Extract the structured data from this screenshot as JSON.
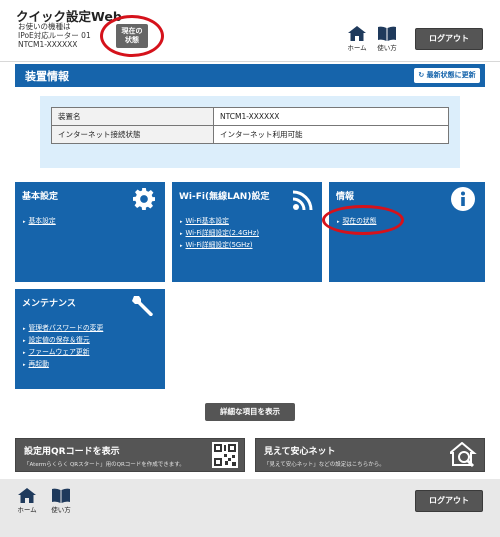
{
  "header": {
    "app_title": "クイック設定Web",
    "device_label": "お使いの機種は",
    "device_model": "IPoE対応ルーター 01",
    "device_id": "NTCM1-XXXXXX",
    "status_button_line1": "現在の",
    "status_button_line2": "状態",
    "home_label": "ホーム",
    "manual_label": "使い方",
    "logout_label": "ログアウト"
  },
  "section": {
    "title": "装置情報",
    "refresh_label": "最新状態に更新"
  },
  "info_table": [
    {
      "key": "装置名",
      "value": "NTCM1-XXXXXX"
    },
    {
      "key": "インターネット接続状態",
      "value": "インターネット利用可能"
    }
  ],
  "tiles": {
    "basic": {
      "title": "基本設定",
      "links": [
        "基本設定"
      ],
      "icon": "gear-icon"
    },
    "wifi": {
      "title": "Wi-Fi(無線LAN)設定",
      "links": [
        "Wi-Fi基本設定",
        "Wi-Fi詳細設定(2.4GHz)",
        "Wi-Fi詳細設定(5GHz)"
      ],
      "icon": "wifi-icon"
    },
    "info": {
      "title": "情報",
      "links": [
        "現在の状態"
      ],
      "icon": "info-icon"
    },
    "maintenance": {
      "title": "メンテナンス",
      "links": [
        "管理者パスワードの変更",
        "設定値の保存＆復元",
        "ファームウェア更新",
        "再起動"
      ],
      "icon": "wrench-icon"
    }
  },
  "advanced_button": "詳細な項目を表示",
  "banners": {
    "qr": {
      "title": "設定用QRコードを表示",
      "subtitle": "「Atermらくらく QRスタート」用のQRコードを作成できます。",
      "icon": "qr-code-icon"
    },
    "safety": {
      "title": "見えて安心ネット",
      "subtitle": "「見えて安心ネット」などの設定はこちらから。",
      "icon": "house-search-icon"
    }
  },
  "footer": {
    "home_label": "ホーム",
    "manual_label": "使い方",
    "logout_label": "ログアウト"
  },
  "colors": {
    "brand_blue": "#1664ab",
    "highlight_red": "#d5121b",
    "button_gray": "#555555"
  }
}
